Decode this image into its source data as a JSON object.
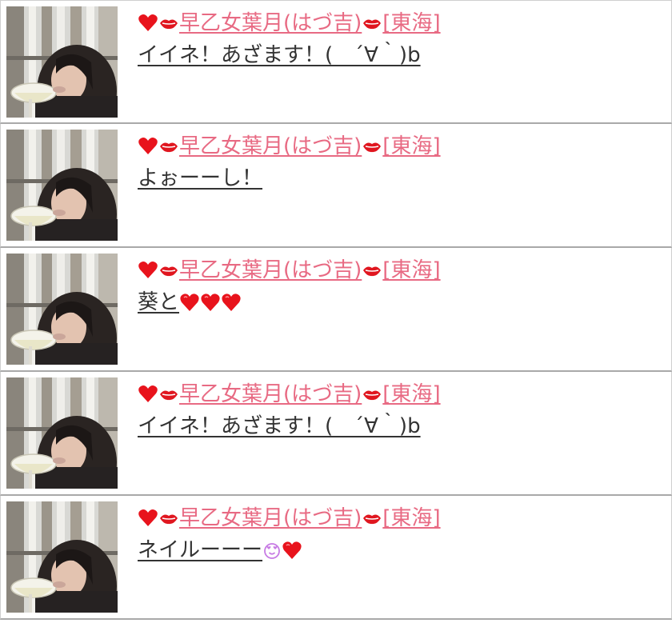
{
  "colors": {
    "name": "#e86a83",
    "message": "#333333",
    "heart": "#e8131c",
    "lips": "#e0161f",
    "smile_face": "#c77be4",
    "divider": "#a9a9a9"
  },
  "comments": [
    {
      "name": {
        "lead_icons": [
          "heart-icon",
          "lips-icon"
        ],
        "text": "早乙女葉月(はづ吉)",
        "trail_icon": "lips-icon",
        "region": "[東海]"
      },
      "message": {
        "text": "イイネ！あざます！(　´∀｀)b",
        "icons": []
      }
    },
    {
      "name": {
        "lead_icons": [
          "heart-icon",
          "lips-icon"
        ],
        "text": "早乙女葉月(はづ吉)",
        "trail_icon": "lips-icon",
        "region": "[東海]"
      },
      "message": {
        "text": "よぉーーし！",
        "icons": []
      }
    },
    {
      "name": {
        "lead_icons": [
          "heart-icon",
          "lips-icon"
        ],
        "text": "早乙女葉月(はづ吉)",
        "trail_icon": "lips-icon",
        "region": "[東海]"
      },
      "message": {
        "text": "葵と",
        "icons": [
          "heart-icon",
          "heart-icon",
          "heart-icon"
        ]
      }
    },
    {
      "name": {
        "lead_icons": [
          "heart-icon",
          "lips-icon"
        ],
        "text": "早乙女葉月(はづ吉)",
        "trail_icon": "lips-icon",
        "region": "[東海]"
      },
      "message": {
        "text": "イイネ！あざます！(　´∀｀)b",
        "icons": []
      }
    },
    {
      "name": {
        "lead_icons": [
          "heart-icon",
          "lips-icon"
        ],
        "text": "早乙女葉月(はづ吉)",
        "trail_icon": "lips-icon",
        "region": "[東海]"
      },
      "message": {
        "text": "ネイルーーー",
        "icons": [
          "heart-eyes-face-icon",
          "heart-icon"
        ]
      }
    }
  ]
}
